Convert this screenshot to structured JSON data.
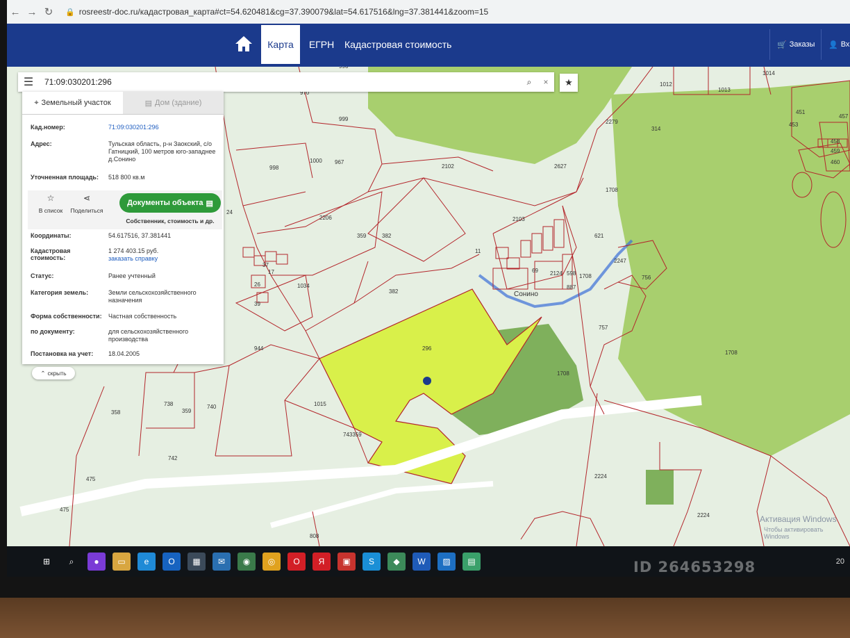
{
  "browser": {
    "url": "rosreestr-doc.ru/кадастровая_карта#ct=54.620481&cg=37.390079&lat=54.617516&lng=37.381441&zoom=15"
  },
  "header": {
    "tab_map": "Карта",
    "tab_egrn": "ЕГРН",
    "tab_cadastral": "Кадастровая стоимость",
    "orders": "Заказы",
    "login": "Вх"
  },
  "search": {
    "value": "71:09:030201:296"
  },
  "panel": {
    "tab_land": "Земельный участок",
    "tab_house": "Дом (здание)",
    "cad_label": "Кад.номер:",
    "cad_value": "71:09:030201:296",
    "address_label": "Адрес:",
    "address_value": "Тульская область, р-н Заокский, с/о Гатницкий, 100 метров юго-западнее д.Сонино",
    "area_label": "Уточненная площадь:",
    "area_value": "518 800 кв.м",
    "favorites": "В список",
    "share": "Поделиться",
    "docs_button": "Документы объекта",
    "docs_sub": "Собственник, стоимость и др.",
    "coords_label": "Координаты:",
    "coords_value": "54.617516, 37.381441",
    "cost_label": "Кадастровая стоимость:",
    "cost_value": "1 274 403.15 руб.",
    "cost_link": "заказать справку",
    "status_label": "Статус:",
    "status_value": "Ранее учтенный",
    "category_label": "Категория земель:",
    "category_value": "Земли сельскохозяйственного назначения",
    "ownership_label": "Форма собственности:",
    "ownership_value": "Частная собственность",
    "bydoc_label": "по документу:",
    "bydoc_value": "для сельскохозяйственного производства",
    "registered_label": "Постановка на учет:",
    "registered_value": "18.04.2005",
    "hide": "скрыть"
  },
  "map_labels": [
    "996",
    "970",
    "999",
    "1000",
    "998",
    "967",
    "1012",
    "1013",
    "1014",
    "2279",
    "314",
    "2102",
    "2627",
    "1708",
    "2206",
    "359",
    "382",
    "2103",
    "621",
    "382",
    "1034",
    "2247",
    "756",
    "2124",
    "757",
    "944",
    "1015",
    "1708",
    "296",
    "738",
    "740",
    "358",
    "359",
    "742",
    "475",
    "475",
    "743359",
    "808",
    "2224",
    "2224",
    "458",
    "459",
    "460",
    "457",
    "451",
    "453",
    "11",
    "37",
    "24",
    "26",
    "17",
    "39",
    "69",
    "598",
    "887",
    "1708",
    "Сонино"
  ],
  "windows": {
    "activation": "Активация Windows",
    "activation_hint": "Чтобы активировать Windows"
  },
  "watermark": "ID 264653298",
  "clock": "20",
  "colors": {
    "header_bg": "#1b3a8c",
    "doc_button": "#2e9a3a",
    "parcel_highlight": "#d9f04a",
    "forest": "#a8cf6e",
    "boundary": "#b3262b"
  }
}
